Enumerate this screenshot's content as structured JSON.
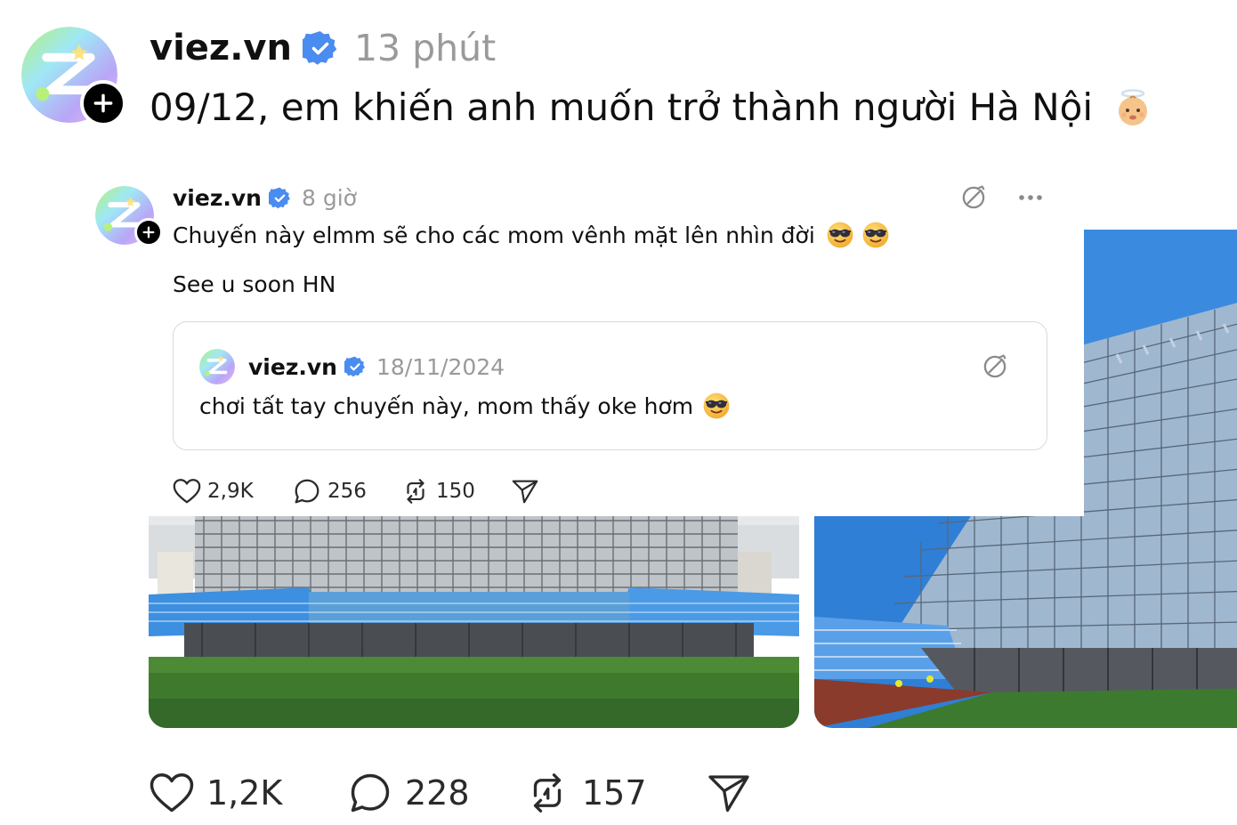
{
  "outer_post": {
    "username": "viez.vn",
    "time": "13 phút",
    "text": "09/12, em khiến anh muốn trở thành người Hà Nội",
    "emoji": "angel-baby-emoji",
    "actions": {
      "likes": "1,2K",
      "replies": "228",
      "reposts": "157"
    }
  },
  "inner_post": {
    "username": "viez.vn",
    "time": "8 giờ",
    "text_line1": "Chuyến này elmm sẽ cho các mom vênh mặt lên nhìn đời",
    "text_line2": "See u soon HN",
    "emoji": "sunglasses-face-emoji",
    "actions": {
      "likes": "2,9K",
      "replies": "256",
      "reposts": "150"
    },
    "quote": {
      "username": "viez.vn",
      "time": "18/11/2024",
      "text": "chơi tất tay chuyến này, mom thấy oke hơm"
    }
  },
  "icons": {
    "verified": "verified-badge-icon",
    "translate": "translate-icon",
    "more": "more-dots-icon",
    "like": "heart-icon",
    "reply": "comment-icon",
    "repost": "repost-icon",
    "share": "send-icon",
    "follow": "plus-icon"
  },
  "colors": {
    "verified_blue": "#4a8cf0",
    "text": "#101010",
    "muted": "#9a9a9a",
    "sky": "#2f7fd6",
    "grass": "#3f7a2c",
    "seats": "#3d8fe0"
  }
}
